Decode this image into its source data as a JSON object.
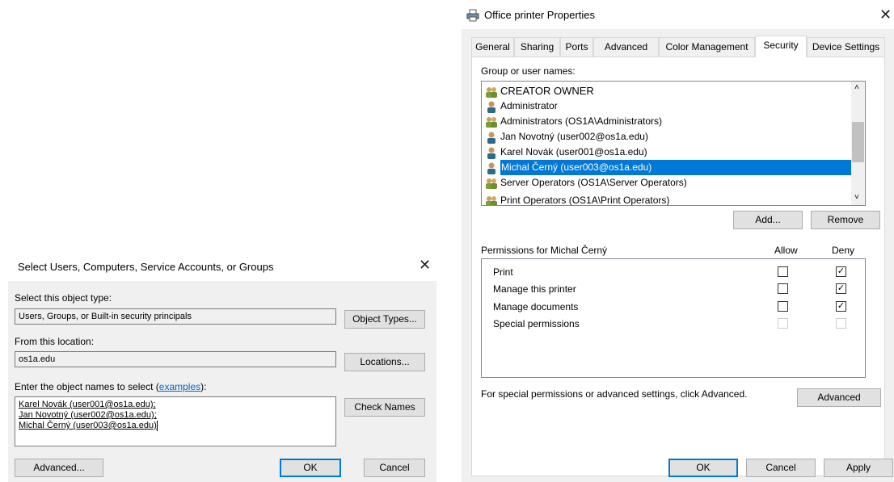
{
  "select_dialog": {
    "title": "Select Users, Computers, Service Accounts, or Groups",
    "object_type_label": "Select this object type:",
    "object_type_value": "Users, Groups, or Built-in security principals",
    "object_types_button": "Object Types...",
    "location_label": "From this location:",
    "location_value": "os1a.edu",
    "locations_button": "Locations...",
    "names_label_prefix": "Enter the object names to select (",
    "names_label_link": "examples",
    "names_label_suffix": "):",
    "names_lines": [
      "Karel Novák (user001@os1a.edu);",
      "Jan Novotný (user002@os1a.edu);",
      "Michal Černý (user003@os1a.edu)"
    ],
    "check_names_button": "Check Names",
    "advanced_button": "Advanced...",
    "ok_button": "OK",
    "cancel_button": "Cancel"
  },
  "props_dialog": {
    "title": "Office printer Properties",
    "tabs": [
      "General",
      "Sharing",
      "Ports",
      "Advanced",
      "Color Management",
      "Security",
      "Device Settings"
    ],
    "active_tab": "Security",
    "group_label": "Group or user names:",
    "users": [
      {
        "name": "CREATOR OWNER",
        "icon": "group-icon"
      },
      {
        "name": "Administrator",
        "icon": "user-icon"
      },
      {
        "name": "Administrators (OS1A\\Administrators)",
        "icon": "group-icon"
      },
      {
        "name": "Jan Novotný (user002@os1a.edu)",
        "icon": "user-icon"
      },
      {
        "name": "Karel Novák (user001@os1a.edu)",
        "icon": "user-icon"
      },
      {
        "name": "Michal Černý (user003@os1a.edu)",
        "icon": "user-icon",
        "selected": true
      },
      {
        "name": "Server Operators (OS1A\\Server Operators)",
        "icon": "group-icon"
      },
      {
        "name": "Print Operators (OS1A\\Print Operators)",
        "icon": "group-icon"
      }
    ],
    "add_button": "Add...",
    "remove_button": "Remove",
    "permissions_label": "Permissions for Michal Černý",
    "allow_header": "Allow",
    "deny_header": "Deny",
    "permissions": [
      {
        "name": "Print",
        "allow": false,
        "deny": true,
        "enabled": true
      },
      {
        "name": "Manage this printer",
        "allow": false,
        "deny": true,
        "enabled": true
      },
      {
        "name": "Manage documents",
        "allow": false,
        "deny": true,
        "enabled": true
      },
      {
        "name": "Special permissions",
        "allow": false,
        "deny": false,
        "enabled": false
      }
    ],
    "special_text": "For special permissions or advanced settings, click Advanced.",
    "advanced_button": "Advanced",
    "ok_button": "OK",
    "cancel_button": "Cancel",
    "apply_button": "Apply"
  },
  "colors": {
    "accent": "#0078d7",
    "dialog_bg": "#f0f0f0",
    "link": "#0066cc"
  }
}
